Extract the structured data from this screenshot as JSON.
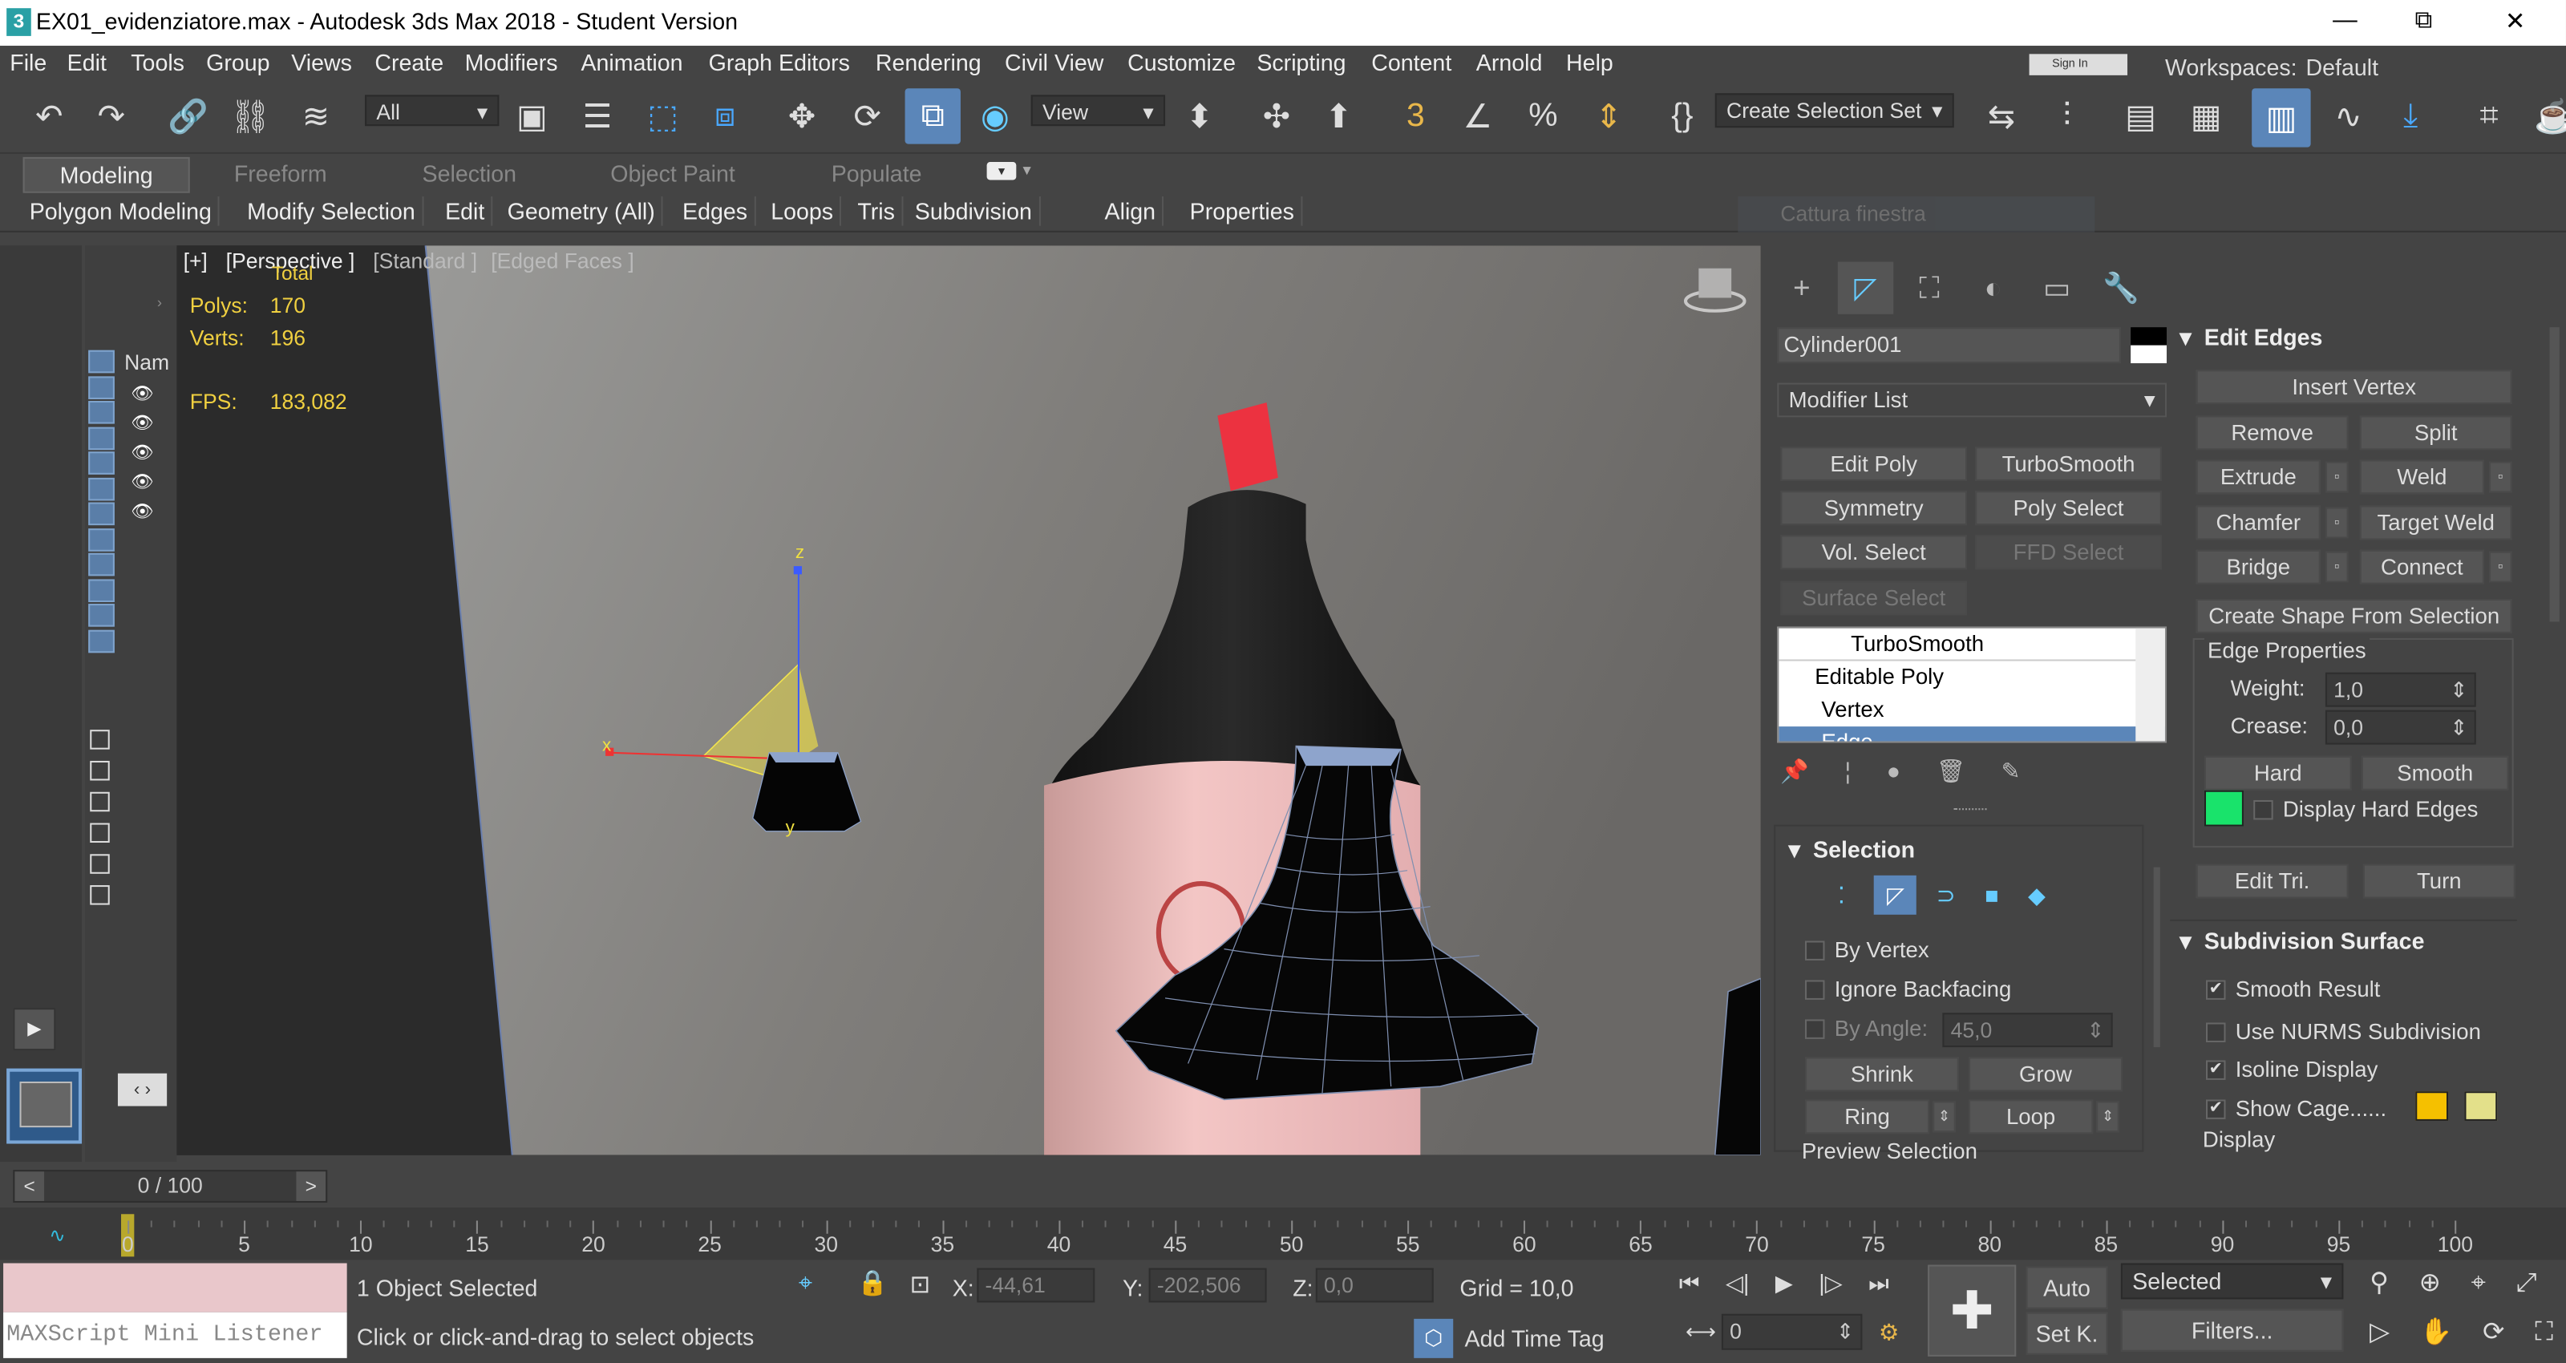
{
  "window": {
    "title": "EX01_evidenziatore.max - Autodesk 3ds Max 2018 - Student Version",
    "app_icon": "3",
    "minimize": "—",
    "restore": "⧉",
    "close": "✕"
  },
  "menu": [
    "File",
    "Edit",
    "Tools",
    "Group",
    "Views",
    "Create",
    "Modifiers",
    "Animation",
    "Graph Editors",
    "Rendering",
    "Civil View",
    "Customize",
    "Scripting",
    "Content",
    "Arnold",
    "Help"
  ],
  "signin": "Sign In",
  "workspaces": {
    "label": "Workspaces:",
    "value": "Default"
  },
  "toolbar": {
    "filter": "All",
    "view": "View",
    "selection_set": "Create Selection Set"
  },
  "ribbon": {
    "tabs": [
      "Modeling",
      "Freeform",
      "Selection",
      "Object Paint",
      "Populate"
    ],
    "subtabs": [
      "Polygon Modeling",
      "Modify Selection",
      "Edit",
      "Geometry (All)",
      "Edges",
      "Loops",
      "Tris",
      "Subdivision",
      "Align",
      "Properties"
    ],
    "ghost": "Cattura finestra"
  },
  "viewport": {
    "label_plus": "[+]",
    "label_view": "[Perspective ]",
    "label_shading": "[Standard ]",
    "label_faces": "[Edged Faces ]",
    "stats": {
      "total": "Total",
      "polys_label": "Polys:",
      "polys": "170",
      "verts_label": "Verts:",
      "verts": "196",
      "fps_label": "FPS:",
      "fps": "183,082"
    },
    "axis": {
      "z": "z",
      "x": "x",
      "y": "y"
    }
  },
  "scene": {
    "name_header": "Nam"
  },
  "panel": {
    "object_name": "Cylinder001",
    "modifier_list": "Modifier List",
    "mod_buttons": [
      "Edit Poly",
      "TurboSmooth",
      "Symmetry",
      "Poly Select",
      "Vol. Select",
      "FFD Select",
      "Surface Select"
    ],
    "stack": [
      "TurboSmooth",
      "Editable Poly",
      "Vertex",
      "Edge"
    ],
    "selection": {
      "title": "Selection",
      "by_vertex": "By Vertex",
      "ignore_backfacing": "Ignore Backfacing",
      "by_angle": "By Angle:",
      "angle": "45,0",
      "shrink": "Shrink",
      "grow": "Grow",
      "ring": "Ring",
      "loop": "Loop",
      "preview": "Preview Selection"
    },
    "edit_edges": {
      "title": "Edit Edges",
      "insert_vertex": "Insert Vertex",
      "remove": "Remove",
      "split": "Split",
      "extrude": "Extrude",
      "weld": "Weld",
      "chamfer": "Chamfer",
      "target_weld": "Target Weld",
      "bridge": "Bridge",
      "connect": "Connect",
      "create_shape": "Create Shape From Selection",
      "edge_props": "Edge Properties",
      "weight_label": "Weight:",
      "weight": "1,0",
      "crease_label": "Crease:",
      "crease": "0,0",
      "hard": "Hard",
      "smooth": "Smooth",
      "display_hard": "Display Hard Edges",
      "edit_tri": "Edit Tri.",
      "turn": "Turn"
    },
    "subdivision": {
      "title": "Subdivision Surface",
      "smooth_result": "Smooth Result",
      "use_nurms": "Use NURMS Subdivision",
      "isoline": "Isoline Display",
      "show_cage": "Show Cage......",
      "display": "Display"
    }
  },
  "timeline": {
    "frame": "0 / 100",
    "ticks": [
      "0",
      "5",
      "10",
      "15",
      "20",
      "25",
      "30",
      "35",
      "40",
      "45",
      "50",
      "55",
      "60",
      "65",
      "70",
      "75",
      "80",
      "85",
      "90",
      "95",
      "100"
    ]
  },
  "status": {
    "maxscript": "MAXScript Mini Listener",
    "selected": "1 Object Selected",
    "prompt": "Click or click-and-drag to select objects",
    "x_label": "X:",
    "x": "-44,61",
    "y_label": "Y:",
    "y": "-202,506",
    "z_label": "Z:",
    "z": "0,0",
    "grid": "Grid = 10,0",
    "add_time_tag": "Add Time Tag",
    "auto": "Auto",
    "setk": "Set K.",
    "selected_dd": "Selected",
    "filters": "Filters...",
    "frame_spin": "0"
  },
  "colors": {
    "accent": "#5b86b9",
    "hard_edge_color": "#19e36b",
    "cage1": "#f5c000",
    "cage2": "#e3e08a",
    "viewport_stats": "#f0d040"
  }
}
